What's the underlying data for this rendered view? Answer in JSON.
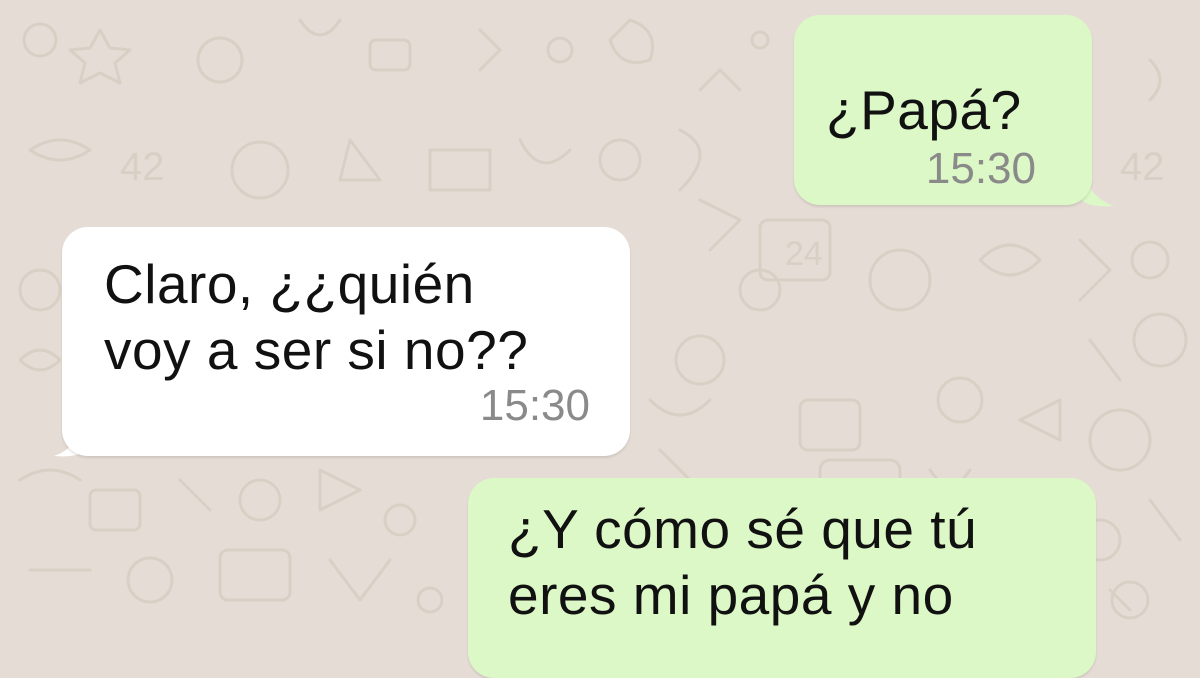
{
  "chat": {
    "wallpaper_color": "#e5ddd5",
    "outgoing_color": "#dcf8c6",
    "incoming_color": "#ffffff",
    "messages": [
      {
        "direction": "outgoing",
        "text_lines": [
          "¿Papá?"
        ],
        "time": "15:30"
      },
      {
        "direction": "incoming",
        "text_lines": [
          "Claro, ¿¿quién",
          "voy a ser si no??"
        ],
        "time": "15:30"
      },
      {
        "direction": "outgoing",
        "text_lines": [
          "¿Y cómo sé que tú",
          "eres mi papá y no"
        ],
        "time": ""
      }
    ]
  }
}
